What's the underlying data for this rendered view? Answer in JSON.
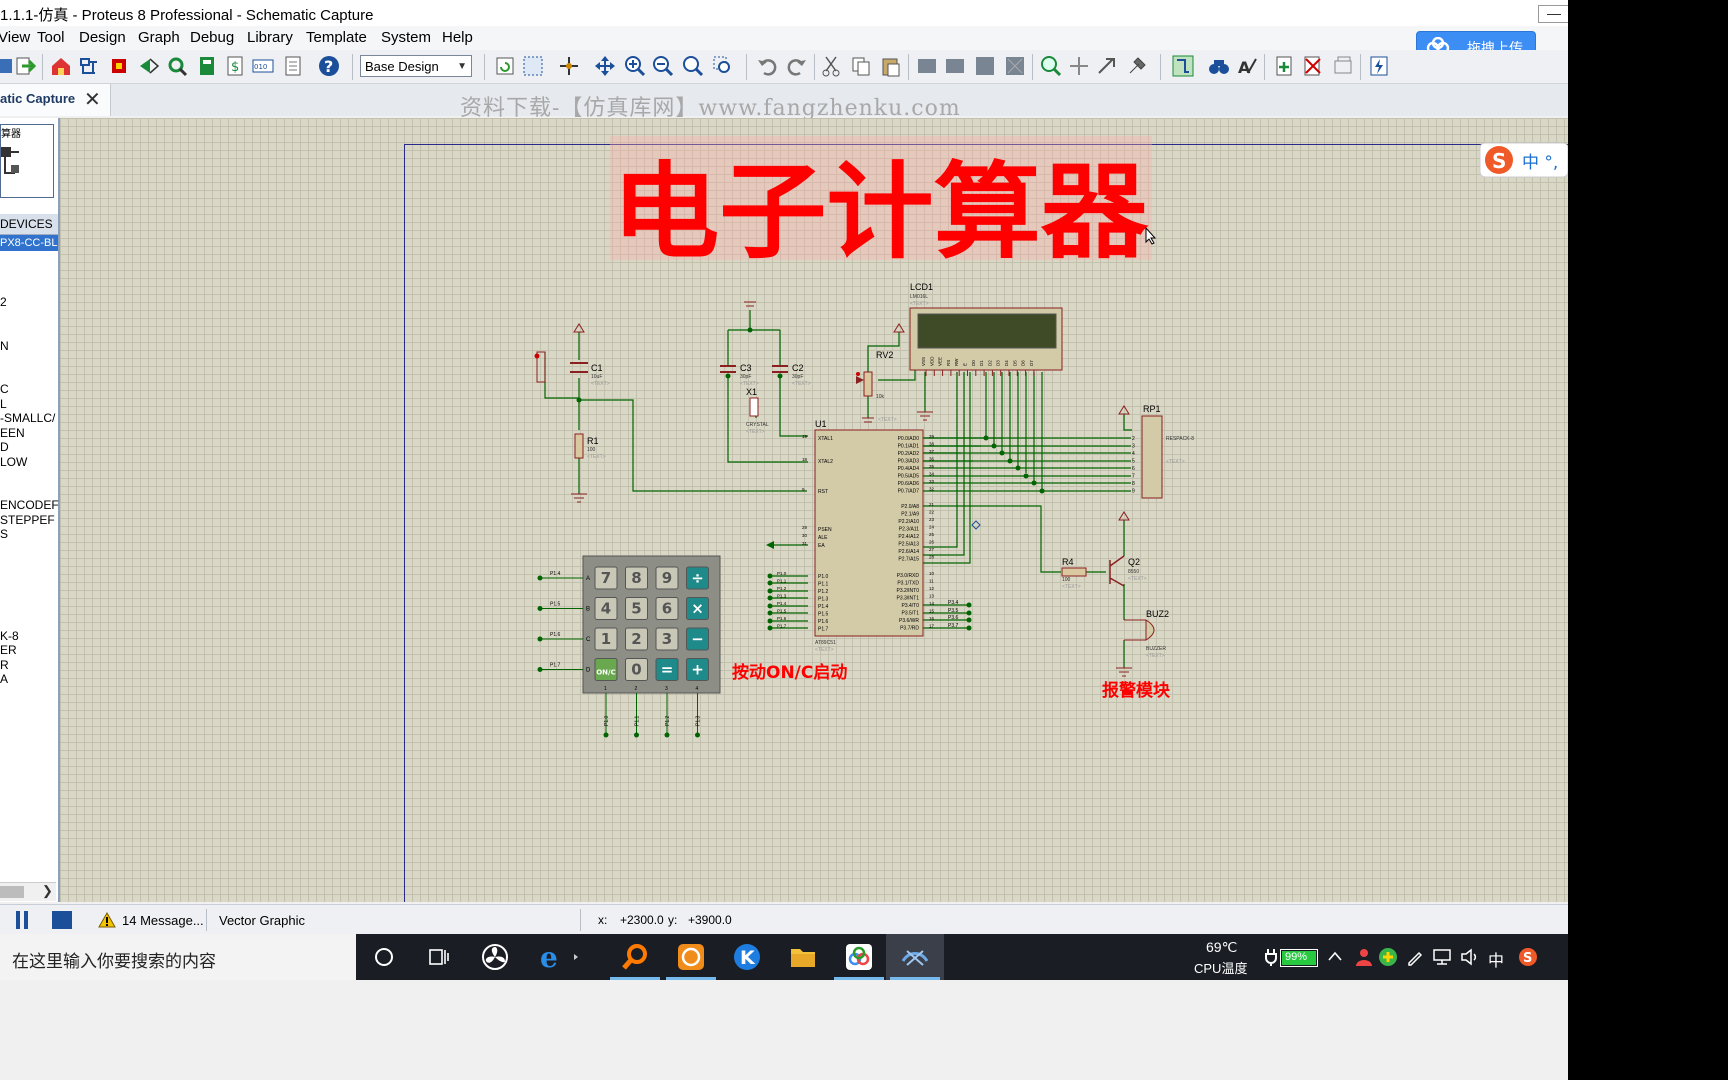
{
  "window": {
    "title": "1.1.1-仿真 - Proteus 8 Professional - Schematic Capture"
  },
  "menu": [
    "View",
    "Tool",
    "Design",
    "Graph",
    "Debug",
    "Library",
    "Template",
    "System",
    "Help"
  ],
  "toolbar": {
    "design_select": "Base Design",
    "cloud_upload": "拖拽上传"
  },
  "tab": {
    "label": "atic Capture",
    "close": "✕"
  },
  "watermark": "资料下载-【仿真库网】www.fangzhenku.com",
  "left_panel": {
    "preview_label": "算器",
    "devices_header": "DEVICES",
    "selected_device": "PX8-CC-BL",
    "devices": [
      "2",
      "N",
      "C",
      "L",
      "-SMALLC/",
      "EEN",
      "D",
      "LOW",
      "ENCODEF",
      "STEPPEF",
      "S",
      "K-8",
      "ER",
      "R",
      "A"
    ]
  },
  "schematic": {
    "title": "电子计算器",
    "note_start": "按动ON/C启动",
    "note_alarm": "报警模块",
    "labels": {
      "lcd": "LCD1",
      "lcd_model": "LM016L",
      "c1": "C1",
      "c1_val": "10uF",
      "r1": "R1",
      "r1_val": "100",
      "c3": "C3",
      "c3_val": "30pF",
      "c2": "C2",
      "c2_val": "30pF",
      "x1": "X1",
      "x1_val": "CRYSTAL",
      "rv2": "RV2",
      "rv2_val": "10k",
      "u1": "U1",
      "u1_model": "AT89C51",
      "rp1": "RP1",
      "rp1_model": "RESPACK-8",
      "r4": "R4",
      "r4_val": "100",
      "q2": "Q2",
      "q2_model": "8550",
      "buz": "BUZ2",
      "buz_model": "BUZZER",
      "text_placeholder": "<TEXT>"
    },
    "u1_left_pins": [
      "XTAL1",
      "XTAL2",
      "RST",
      "PSEN",
      "ALE",
      "EA"
    ],
    "u1_left_nums": [
      "19",
      "18",
      "9",
      "29",
      "30",
      "31"
    ],
    "u1_p1_pins": [
      "P1.0",
      "P1.1",
      "P1.2",
      "P1.3",
      "P1.4",
      "P1.5",
      "P1.6",
      "P1.7"
    ],
    "u1_p0_pins": [
      "P0.0/AD0",
      "P0.1/AD1",
      "P0.2/AD2",
      "P0.3/AD3",
      "P0.4/AD4",
      "P0.5/AD5",
      "P0.6/AD6",
      "P0.7/AD7"
    ],
    "u1_p0_nums": [
      "39",
      "38",
      "37",
      "36",
      "35",
      "34",
      "33",
      "32"
    ],
    "u1_p2_pins": [
      "P2.0/A8",
      "P2.1/A9",
      "P2.2/A10",
      "P2.3/A11",
      "P2.4/A12",
      "P2.5/A13",
      "P2.6/A14",
      "P2.7/A15"
    ],
    "u1_p2_nums": [
      "21",
      "22",
      "23",
      "24",
      "25",
      "26",
      "27",
      "28"
    ],
    "u1_p3_pins": [
      "P3.0/RXD",
      "P3.1/TXD",
      "P3.2/INT0",
      "P3.3/INT1",
      "P3.4/T0",
      "P3.5/T1",
      "P3.6/WR",
      "P3.7/RD"
    ],
    "u1_p3_nums": [
      "10",
      "11",
      "12",
      "13",
      "14",
      "15",
      "16",
      "17"
    ],
    "p3_net_labels": [
      "P3.4",
      "P3.5",
      "P3.6",
      "P3.7"
    ],
    "lcd_pins": [
      "VSS",
      "VDD",
      "VEE",
      "RS",
      "RW",
      "E",
      "D0",
      "D1",
      "D2",
      "D3",
      "D4",
      "D5",
      "D6",
      "D7"
    ],
    "keypad": {
      "rows": [
        "A",
        "B",
        "C",
        "D"
      ],
      "row_nets": [
        "P1.4",
        "P1.5",
        "P1.6",
        "P1.7"
      ],
      "col_nums": [
        "1",
        "2",
        "3",
        "4"
      ],
      "col_nets": [
        "P1.0",
        "P1.1",
        "P1.2",
        "P1.3"
      ],
      "keys": [
        [
          "7",
          "8",
          "9",
          "÷"
        ],
        [
          "4",
          "5",
          "6",
          "×"
        ],
        [
          "1",
          "2",
          "3",
          "−"
        ],
        [
          "ON/C",
          "0",
          "=",
          "+"
        ]
      ]
    }
  },
  "status": {
    "messages": "14 Message...",
    "mode": "Vector Graphic",
    "x_label": "x:",
    "x_value": "+2300.0",
    "y_label": "y:",
    "y_value": "+3900.0"
  },
  "taskbar": {
    "search_placeholder": "在这里输入你要搜索的内容",
    "temp": "69℃",
    "temp_label": "CPU温度",
    "battery": "99%",
    "ime": "中",
    "ime_brand": "中 °,"
  },
  "colors": {
    "accent": "#3173cc",
    "title_red": "#ff0000",
    "wire": "#006400",
    "component": "#8b2020",
    "canvas": "#d9d7c5"
  }
}
